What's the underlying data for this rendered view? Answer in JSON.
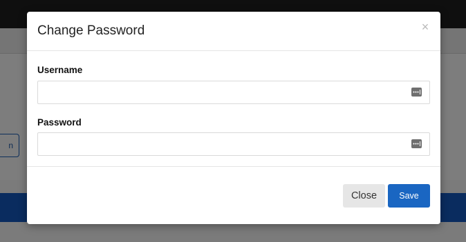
{
  "background": {
    "partial_button_label": "n"
  },
  "modal": {
    "title": "Change Password",
    "close_symbol": "×",
    "fields": {
      "username": {
        "label": "Username",
        "value": "",
        "icon": "password-manager-key-icon"
      },
      "password": {
        "label": "Password",
        "value": "",
        "icon": "password-manager-key-icon"
      }
    },
    "buttons": {
      "close_label": "Close",
      "save_label": "Save"
    }
  },
  "colors": {
    "primary": "#1a66c2",
    "secondary_button": "#e6e6e6",
    "overlay_band": "#0a2c5f"
  }
}
